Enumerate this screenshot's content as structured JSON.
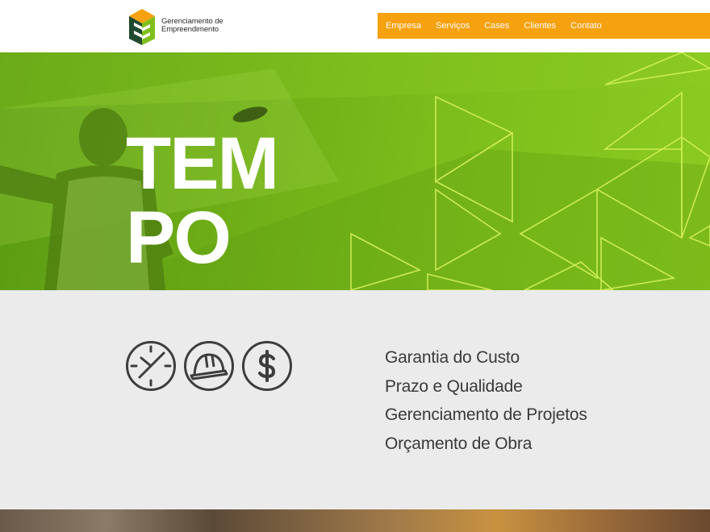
{
  "brand": {
    "line1": "Gerenciamento de",
    "line2": "Empreendimento",
    "colors": {
      "orange": "#f6a10f",
      "dark_green": "#1f4a2f",
      "lime": "#7fbf1c"
    }
  },
  "nav": {
    "items": [
      "Empresa",
      "Serviços",
      "Cases",
      "Clientes",
      "Contato"
    ],
    "background": "#f6a10f"
  },
  "hero": {
    "title_line1": "TEM",
    "title_line2": "PO",
    "overlay_color": "#7fbf1c"
  },
  "features": {
    "icons": [
      "clock-icon",
      "hard-hat-icon",
      "dollar-icon"
    ],
    "items": [
      "Garantia do Custo",
      "Prazo e Qualidade",
      "Gerenciamento de Projetos",
      "Orçamento de Obra"
    ]
  }
}
